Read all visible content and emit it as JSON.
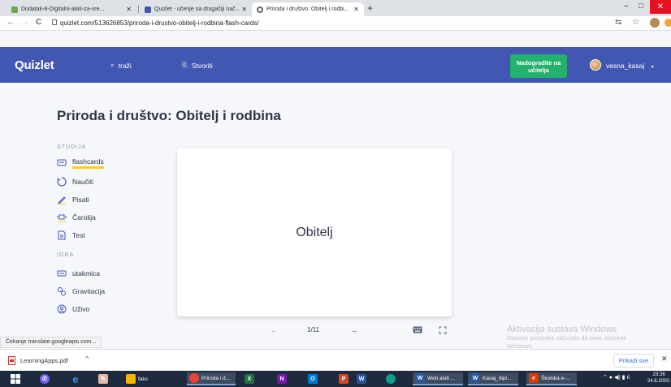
{
  "browser": {
    "tabs": [
      {
        "title": "Dodatak-8-Digitalni-alati-za-vre...",
        "active": false,
        "icon_color": "#6aa84f"
      },
      {
        "title": "Quizlet - učenje na drugačiji nač...",
        "active": false,
        "icon_color": "#4257b2"
      },
      {
        "title": "Priroda i društvo: Obitelj i rodbi...",
        "active": true,
        "icon_color": "#5f6368"
      }
    ],
    "new_tab": "+",
    "url": "quizlet.com/513626853/priroda-i-drustvo-obitelj-i-rodbina-flash-cards/",
    "back": "←",
    "forward": "→",
    "reload": "C",
    "star": "☆"
  },
  "header": {
    "logo": "Quizlet",
    "search_label": "traži",
    "create_label": "Stvoriti",
    "upgrade_label": "Nadogradite na učitelja",
    "username": "vesna_kasaj",
    "user_caret": "▾",
    "brand_color": "#4257b2",
    "upgrade_color": "#23b26d"
  },
  "page": {
    "title": "Priroda i društvo: Obitelj i rodbina",
    "study_section": "STUDIJA",
    "study_items": [
      {
        "label": "flashcards",
        "icon": "cards-icon",
        "active": true
      },
      {
        "label": "Naučiti",
        "icon": "learn-icon",
        "active": false
      },
      {
        "label": "Pisati",
        "icon": "write-icon",
        "active": false
      },
      {
        "label": "Čarolija",
        "icon": "spell-icon",
        "active": false
      },
      {
        "label": "Test",
        "icon": "test-icon",
        "active": false
      }
    ],
    "game_section": "IGRA",
    "game_items": [
      {
        "label": "utakmica",
        "icon": "match-icon"
      },
      {
        "label": "Gravitacija",
        "icon": "gravity-icon"
      },
      {
        "label": "Uživo",
        "icon": "live-icon"
      }
    ],
    "card": {
      "term": "Obitelj",
      "counter": "1/11",
      "prev": "←",
      "next": "→"
    }
  },
  "watermark": {
    "title": "Aktivacija sustava Windows",
    "line1": "Otvorite postavke računala da biste aktivirali",
    "line2": "Windows."
  },
  "status_text": "Čekanje translate.googleapis.com...",
  "downloads": {
    "file": "LearningApps.pdf",
    "show_all": "Prikaži sve",
    "close": "✕"
  },
  "taskbar": {
    "items": [
      {
        "label": "faks",
        "color": "#f4b400",
        "open": false
      },
      {
        "label": "Priroda i d...",
        "color": "#ea4335",
        "open": true
      },
      {
        "label": "Web alati ...",
        "color": "#2b579a",
        "open": true
      },
      {
        "label": "Kasaj_dipl...",
        "color": "#2b579a",
        "open": true
      },
      {
        "label": "Školska e-...",
        "color": "#d83b01",
        "open": true
      }
    ],
    "time": "23:26",
    "date": "24.6.2020."
  }
}
